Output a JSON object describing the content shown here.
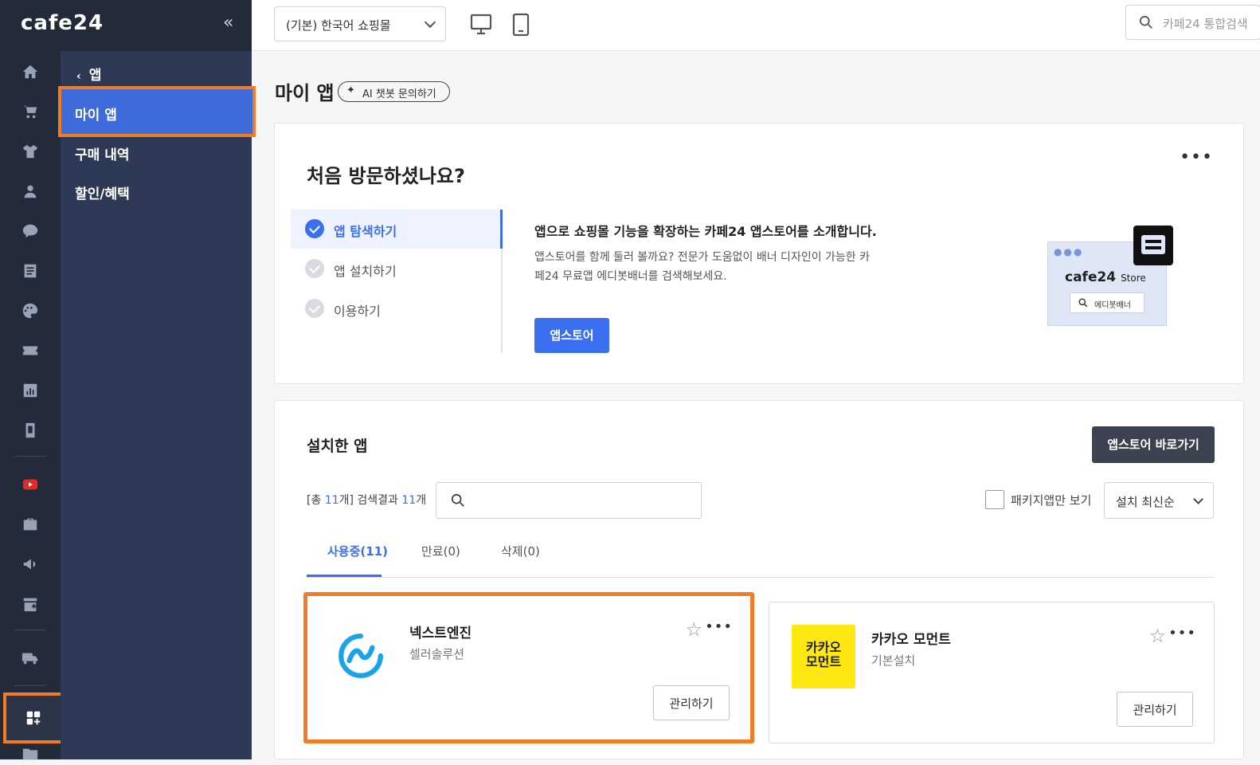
{
  "brand": {
    "logo": "cafe24",
    "collapse": "«",
    "accent": "#3a6ff0",
    "highlight": "#f07c25"
  },
  "sidebar": {
    "back_label": "앱",
    "items": [
      {
        "label": "마이 앱"
      },
      {
        "label": "구매 내역"
      },
      {
        "label": "할인/혜택"
      }
    ],
    "rail_icons": [
      "home-icon",
      "cart-icon",
      "shirt-icon",
      "user-icon",
      "chat-icon",
      "board-icon",
      "palette-icon",
      "coupon-icon",
      "stats-icon",
      "mobile-shop-icon",
      "youtube-icon",
      "bag-icon",
      "megaphone-icon",
      "store-add-icon",
      "truck-icon",
      "apps-icon",
      "folder-icon"
    ]
  },
  "topbar": {
    "shop_select": "(기본) 한국어 쇼핑몰",
    "search_placeholder": "카페24 통합검색"
  },
  "page": {
    "title": "마이 앱",
    "ai_chip": "AI 챗봇 문의하기"
  },
  "welcome": {
    "title": "처음 방문하셨나요?",
    "more": "•••",
    "steps": [
      "앱 탐색하기",
      "앱 설치하기",
      "이용하기"
    ],
    "active_step": 0,
    "intro_title": "앱으로 쇼핑몰 기능을 확장하는 카페24 앱스토어를 소개합니다.",
    "intro_body": "앱스토어를 함께 둘러 볼까요? 전문가 도움없이 배너 디자인이 가능한 카페24 무료앱 에디봇배너를 검색해보세요.",
    "button": "앱스토어",
    "illus_logo": "cafe24",
    "illus_store": "Store",
    "illus_search": "에디봇배너"
  },
  "installed": {
    "title": "설치한 앱",
    "store_button": "앱스토어 바로가기",
    "count_prefix": "[총 ",
    "total": "11",
    "count_mid": "개] 검색결과 ",
    "results": "11",
    "count_suffix": "개",
    "package_only": "패키지앱만 보기",
    "sort": "설치 최신순",
    "tabs": [
      {
        "label": "사용중(11)"
      },
      {
        "label": "만료(0)"
      },
      {
        "label": "삭제(0)"
      }
    ],
    "apps": [
      {
        "name": "넥스트엔진",
        "vendor": "셀러솔루션",
        "manage": "관리하기"
      },
      {
        "name": "카카오 모먼트",
        "vendor": "기본설치",
        "manage": "관리하기",
        "logo_text_1": "카카오",
        "logo_text_2": "모먼트"
      }
    ]
  }
}
